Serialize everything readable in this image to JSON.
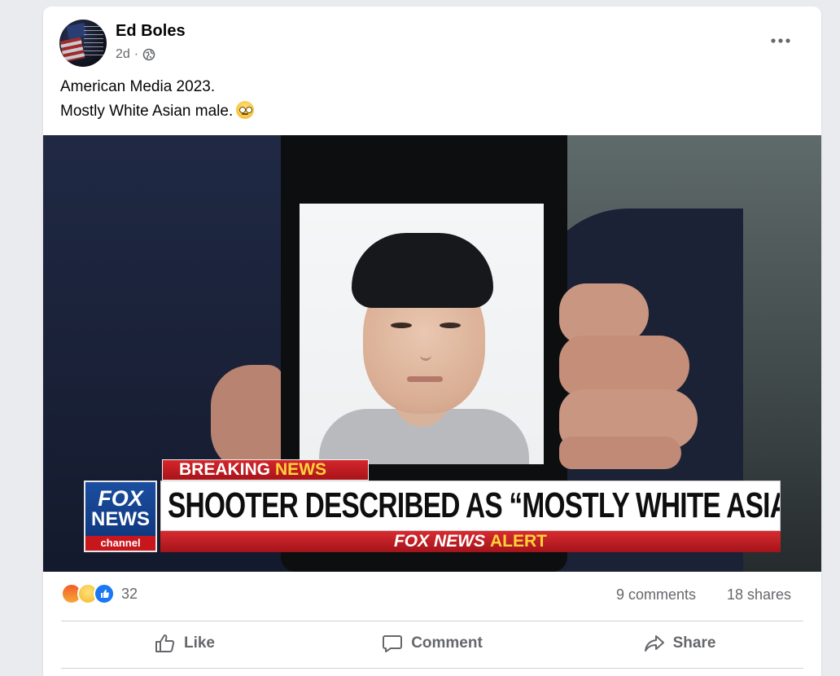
{
  "post": {
    "author": "Ed Boles",
    "time": "2d",
    "separator": "·",
    "privacy_icon": "globe-icon",
    "more_icon": "more-options-icon",
    "text_line1": "American Media 2023.",
    "text_line2": "Mostly White Asian male.",
    "text_emoji": "face-with-rolling-eyes-emoji"
  },
  "image": {
    "breaking": "BREAKING",
    "breaking_news": "NEWS",
    "logo_line1": "FOX",
    "logo_line2": "NEWS",
    "logo_line3": "channel",
    "headline": "SHOOTER DESCRIBED AS “MOSTLY WHITE ASIAN MALE”",
    "alert_prefix": "FOX NEWS",
    "alert_word": "ALERT"
  },
  "stats": {
    "reaction_icons": [
      "angry-icon",
      "haha-icon",
      "like-icon"
    ],
    "reaction_count": "32",
    "comments": "9 comments",
    "shares": "18 shares"
  },
  "actions": {
    "like": "Like",
    "comment": "Comment",
    "share": "Share"
  },
  "colors": {
    "link_gray": "#65676b",
    "like_blue": "#1877f2",
    "fox_red": "#c8161d",
    "fox_blue": "#0d3376",
    "alert_yellow": "#ffd23a"
  }
}
